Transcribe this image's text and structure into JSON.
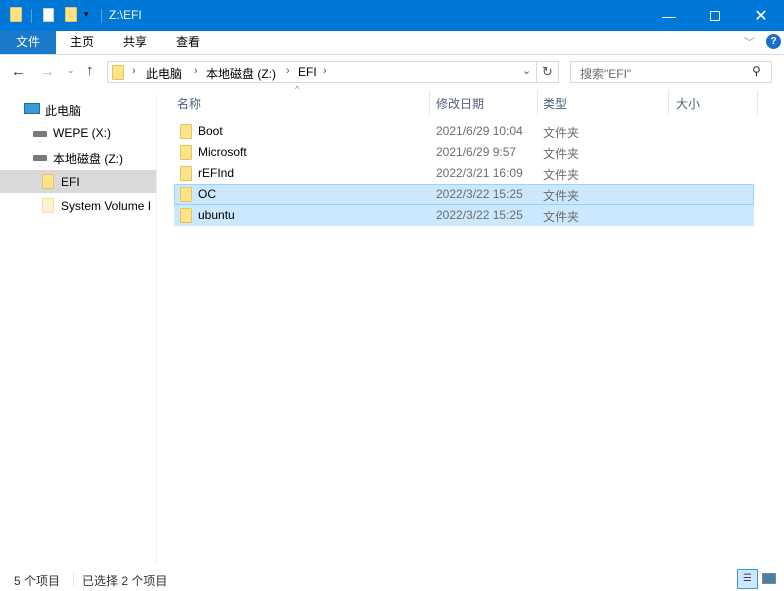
{
  "window": {
    "title": "Z:\\EFI"
  },
  "ribbon": {
    "tabs": [
      "文件",
      "主页",
      "共享",
      "查看"
    ]
  },
  "address": {
    "crumbs": [
      "此电脑",
      "本地磁盘 (Z:)",
      "EFI"
    ]
  },
  "search": {
    "placeholder": "搜索\"EFI\""
  },
  "nav": {
    "items": [
      {
        "label": "此电脑",
        "icon": "computer-icon"
      },
      {
        "label": "WEPE (X:)",
        "icon": "drive-icon"
      },
      {
        "label": "本地磁盘 (Z:)",
        "icon": "drive-icon"
      },
      {
        "label": "EFI",
        "icon": "folder-icon",
        "selected": true
      },
      {
        "label": "System Volume I",
        "icon": "folder-icon"
      }
    ]
  },
  "columns": [
    "名称",
    "修改日期",
    "类型",
    "大小"
  ],
  "files": [
    {
      "name": "Boot",
      "date": "2021/6/29 10:04",
      "type": "文件夹",
      "selected": false
    },
    {
      "name": "Microsoft",
      "date": "2021/6/29 9:57",
      "type": "文件夹",
      "selected": false
    },
    {
      "name": "rEFInd",
      "date": "2022/3/21 16:09",
      "type": "文件夹",
      "selected": false
    },
    {
      "name": "OC",
      "date": "2022/3/22 15:25",
      "type": "文件夹",
      "selected": true
    },
    {
      "name": "ubuntu",
      "date": "2022/3/22 15:25",
      "type": "文件夹",
      "selected": true
    }
  ],
  "status": {
    "count": "5 个项目",
    "selected": "已选择 2 个项目"
  },
  "colors": {
    "titlebar": "#0078d7",
    "selection": "#cce8ff"
  }
}
